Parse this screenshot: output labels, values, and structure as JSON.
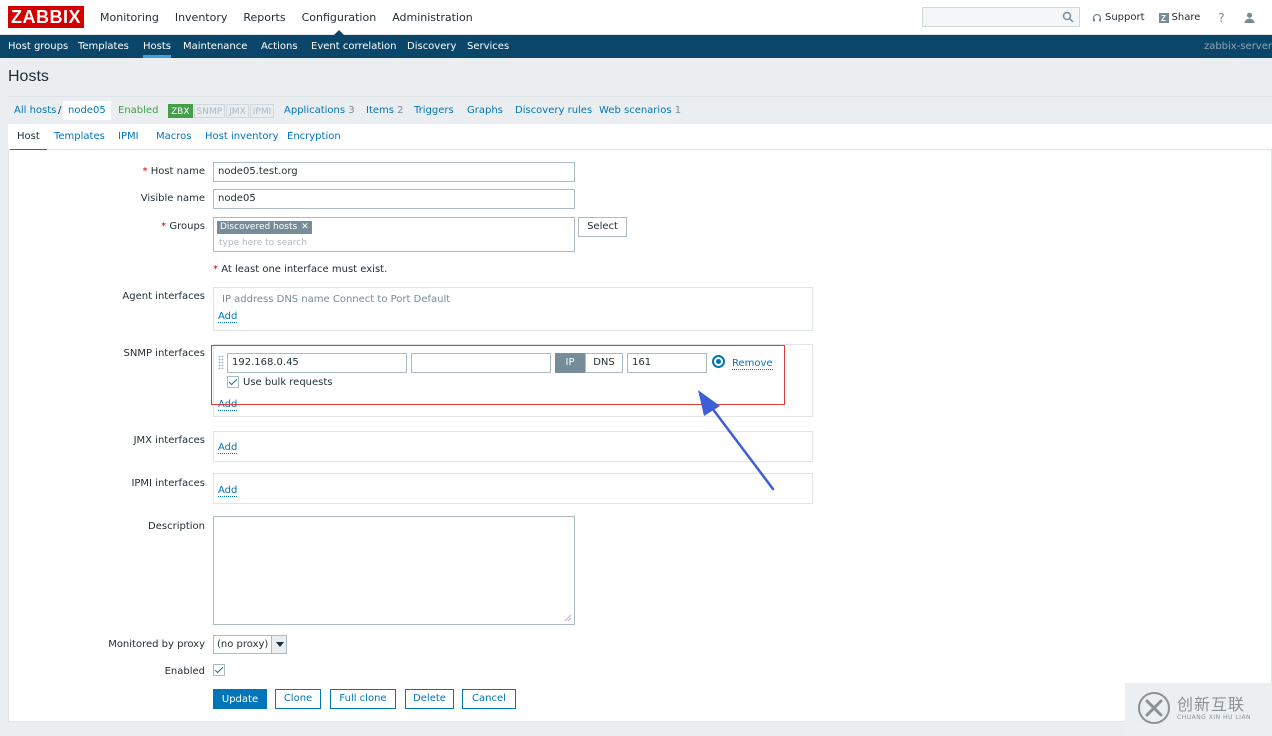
{
  "logo": "ZABBIX",
  "main_menu": [
    "Monitoring",
    "Inventory",
    "Reports",
    "Configuration",
    "Administration"
  ],
  "main_menu_active": "Configuration",
  "top_links": {
    "support": "Support",
    "share": "Share",
    "help": "?"
  },
  "sub_menu": [
    "Host groups",
    "Templates",
    "Hosts",
    "Maintenance",
    "Actions",
    "Event correlation",
    "Discovery",
    "Services"
  ],
  "sub_menu_active": "Hosts",
  "server_name": "zabbix-server",
  "page_title": "Hosts",
  "host_nav": {
    "all_hosts": "All hosts",
    "current": "node05",
    "status": "Enabled",
    "availability": [
      "ZBX",
      "SNMP",
      "JMX",
      "IPMI"
    ],
    "applications": "Applications",
    "applications_count": "3",
    "items": "Items",
    "items_count": "2",
    "triggers": "Triggers",
    "graphs": "Graphs",
    "discovery_rules": "Discovery rules",
    "web_scenarios": "Web scenarios",
    "web_scenarios_count": "1"
  },
  "form_tabs": [
    "Host",
    "Templates",
    "IPMI",
    "Macros",
    "Host inventory",
    "Encryption"
  ],
  "form_tab_active": "Host",
  "form": {
    "host_name_label": "Host name",
    "host_name": "node05.test.org",
    "visible_name_label": "Visible name",
    "visible_name": "node05",
    "groups_label": "Groups",
    "group_tag": "Discovered hosts",
    "groups_placeholder": "type here to search",
    "select_button": "Select",
    "interface_note": "At least one interface must exist.",
    "agent_label": "Agent interfaces",
    "agent_headers": "IP address DNS name Connect to Port Default",
    "add": "Add",
    "snmp_label": "SNMP interfaces",
    "snmp_ip": "192.168.0.45",
    "snmp_dns": "",
    "connect_ip": "IP",
    "connect_dns": "DNS",
    "snmp_port": "161",
    "remove": "Remove",
    "bulk_label": "Use bulk requests",
    "jmx_label": "JMX interfaces",
    "ipmi_label": "IPMI interfaces",
    "description_label": "Description",
    "proxy_label": "Monitored by proxy",
    "proxy_value": "(no proxy)",
    "enabled_label": "Enabled"
  },
  "buttons": {
    "update": "Update",
    "clone": "Clone",
    "full_clone": "Full clone",
    "delete": "Delete",
    "cancel": "Cancel"
  },
  "watermark": {
    "text": "创新互联",
    "sub": "CHUANG XIN HU LIAN"
  },
  "colors": {
    "brand": "#d40000",
    "nav": "#0a466a",
    "link": "#0275b8",
    "enabled": "#429e47",
    "highlight": "#e0393c",
    "arrow": "#3d5fd6"
  }
}
